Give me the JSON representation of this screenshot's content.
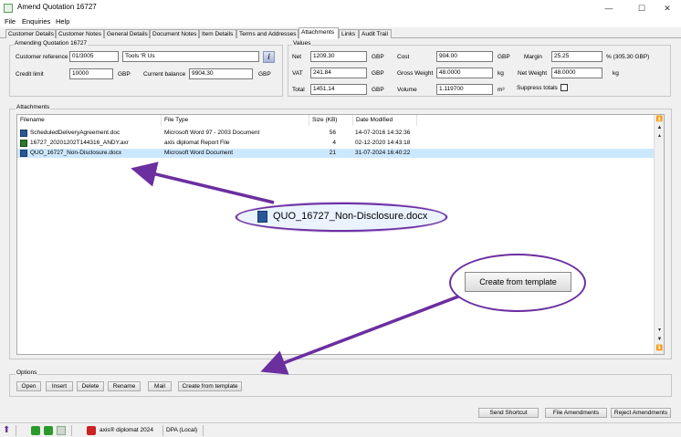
{
  "window": {
    "title": "Amend Quotation 16727",
    "controls": {
      "minimize": "—",
      "maximize": "☐",
      "close": "✕"
    }
  },
  "menu": [
    "File",
    "Enquiries",
    "Help"
  ],
  "tabs": [
    "Customer Details",
    "Customer Notes",
    "General Details",
    "Document Notes",
    "Item Details",
    "Terms and Addresses",
    "Attachments",
    "Links",
    "Audit Trail"
  ],
  "active_tab": "Attachments",
  "amending": {
    "legend": "Amending Quotation 16727",
    "customer_reference_label": "Customer reference",
    "customer_reference": "01/3005",
    "customer_name": "Tools 'R Us",
    "credit_limit_label": "Credit limit",
    "credit_limit": "10000",
    "credit_currency": "GBP",
    "current_balance_label": "Current balance",
    "current_balance": "9904.30",
    "balance_currency": "GBP",
    "info_glyph": "i"
  },
  "values": {
    "legend": "Values",
    "net_label": "Net",
    "net": "1209.30",
    "net_cur": "GBP",
    "vat_label": "VAT",
    "vat": "241.84",
    "vat_cur": "GBP",
    "total_label": "Total",
    "total": "1451.14",
    "total_cur": "GBP",
    "cost_label": "Cost",
    "cost": "904.00",
    "cost_cur": "GBP",
    "gross_label": "Gross Weight",
    "gross": "48.0000",
    "gross_unit": "kg",
    "volume_label": "Volume",
    "volume": "1.119700",
    "volume_unit": "m³",
    "margin_label": "Margin",
    "margin": "25.25",
    "margin_note": "% (305.30 GBP)",
    "netw_label": "Net Weight",
    "netw": "48.0000",
    "netw_unit": "kg",
    "suppress_label": "Suppress totals"
  },
  "attachments": {
    "legend": "Attachments",
    "headers": [
      "Filename",
      "File Type",
      "Size (KB)",
      "Date Modified"
    ],
    "rows": [
      {
        "filename": "ScheduledDeliveryAgreement.doc",
        "type": "Microsoft Word 97 - 2003 Document",
        "size": "56",
        "date": "14-07-2016 14:32:36",
        "icon": "word-icon"
      },
      {
        "filename": "16727_20201202T144316_ANDY.axr",
        "type": "axis diplomat Report File",
        "size": "4",
        "date": "02-12-2020 14:43:18",
        "icon": "axis-report-icon"
      },
      {
        "filename": "QUO_16727_Non-Disclosure.docx",
        "type": "Microsoft Word Document",
        "size": "21",
        "date": "31-07-2024 16:40:22",
        "icon": "word-icon"
      }
    ]
  },
  "options": {
    "legend": "Options",
    "buttons": [
      "Open",
      "Insert",
      "Delete",
      "Rename",
      "Mail",
      "Create from template"
    ]
  },
  "bottom_buttons": [
    "Send Shortcut",
    "File Amendments",
    "Reject Amendments"
  ],
  "status": {
    "app": "axis® diplomat 2024",
    "db": "DPA (Local)"
  },
  "callouts": {
    "file": "QUO_16727_Non-Disclosure.docx",
    "button": "Create from template"
  },
  "colors": {
    "annotation": "#6b2fa0",
    "selection": "#cce8ff"
  }
}
